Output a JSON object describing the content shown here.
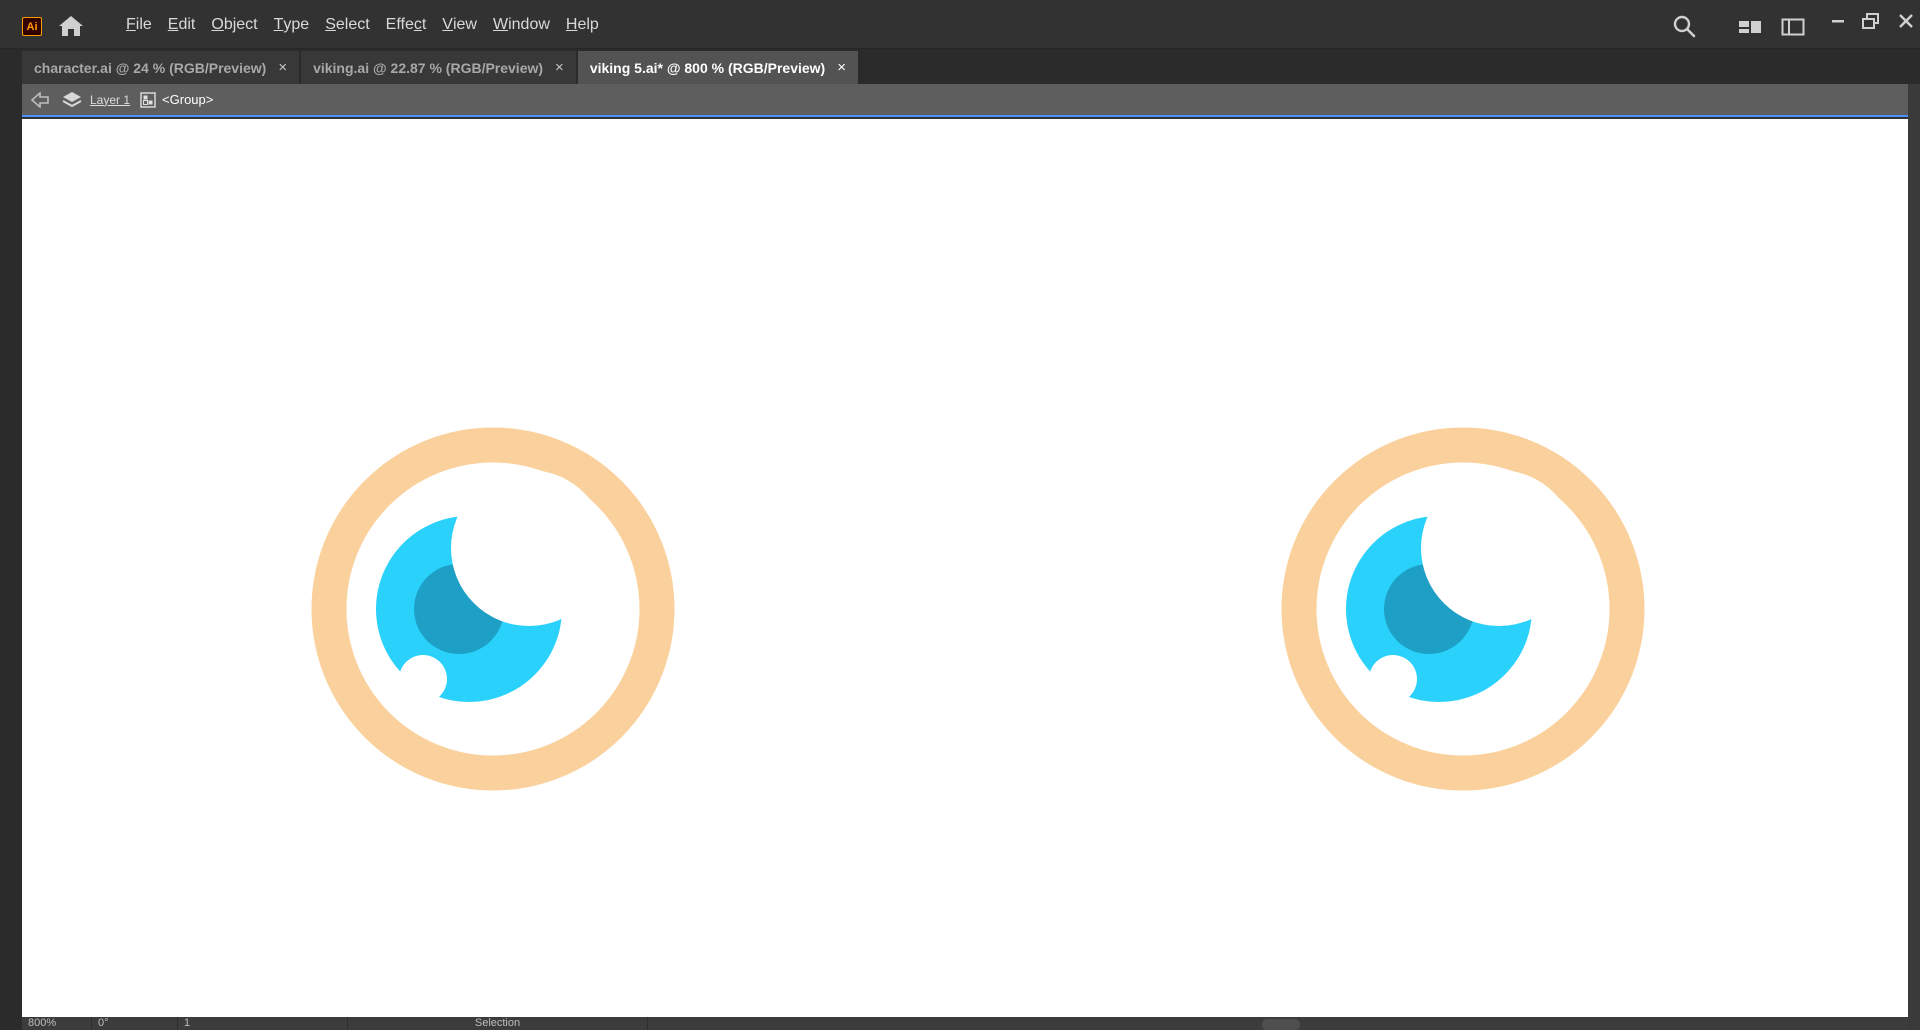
{
  "app": {
    "logo_text": "Ai",
    "accent_color": "#ff9a00"
  },
  "menu": {
    "items": [
      {
        "u": "F",
        "rest": "ile"
      },
      {
        "u": "E",
        "rest": "dit"
      },
      {
        "u": "O",
        "rest": "bject"
      },
      {
        "u": "T",
        "rest": "ype"
      },
      {
        "u": "S",
        "rest": "elect"
      },
      {
        "pre": "Effe",
        "u": "c",
        "rest": "t"
      },
      {
        "u": "V",
        "rest": "iew"
      },
      {
        "u": "W",
        "rest": "indow"
      },
      {
        "u": "H",
        "rest": "elp"
      }
    ]
  },
  "tabs": [
    {
      "label": "character.ai @ 24 % (RGB/Preview)",
      "close": "×",
      "active": false
    },
    {
      "label": "viking.ai @ 22.87 % (RGB/Preview)",
      "close": "×",
      "active": false
    },
    {
      "label": "viking 5.ai* @ 800 % (RGB/Preview)",
      "close": "×",
      "active": true
    }
  ],
  "isolation": {
    "layer_label": "Layer 1",
    "group_label": "<Group>"
  },
  "artwork": {
    "ring_color": "#fad19c",
    "iris_color": "#29d1fb",
    "pupil_color": "#1e9fc6",
    "highlight_color": "#ffffff"
  },
  "status": {
    "zoom": "800%",
    "rotation": "0°",
    "artboard": "1",
    "tool": "Selection"
  },
  "icons": {
    "home": "home-icon",
    "search": "search-icon",
    "workspace": "arrange-documents-icon",
    "panel": "workspace-switcher-icon",
    "minimize": "minimize-icon",
    "restore": "restore-icon",
    "close": "close-icon",
    "back": "back-arrow-icon",
    "layers": "layers-icon",
    "group": "group-icon"
  }
}
